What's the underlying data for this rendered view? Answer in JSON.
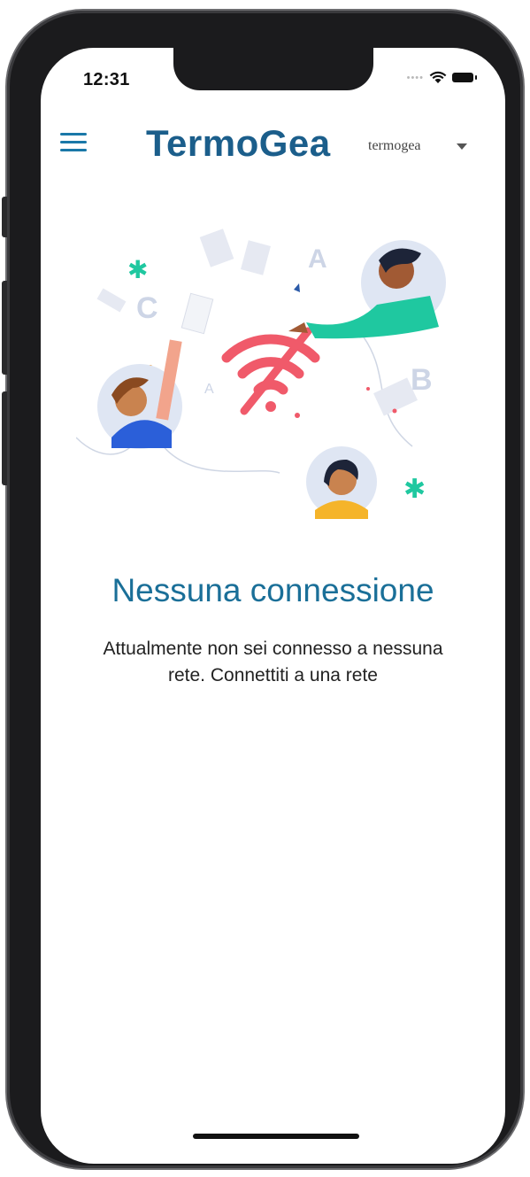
{
  "status_bar": {
    "time": "12:31"
  },
  "header": {
    "logo_text": "TermoGea",
    "account": "termogea"
  },
  "main": {
    "title": "Nessuna connessione",
    "message": "Attualmente non sei connesso a nessuna rete. Connettiti a una rete"
  },
  "illustration": {
    "letters": [
      "A",
      "B",
      "C",
      "A"
    ]
  },
  "colors": {
    "primary": "#1a6f98",
    "logo": "#1b5e8b",
    "wifi_off": "#f05a6a",
    "accent_green": "#1fc8a0"
  }
}
